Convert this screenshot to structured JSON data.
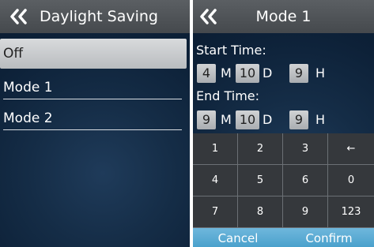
{
  "left_screen": {
    "title": "Daylight Saving",
    "back_icon": "double-chevron-left-icon",
    "menu": [
      {
        "label": "Off",
        "selected": true
      },
      {
        "label": "Mode 1",
        "selected": false
      },
      {
        "label": "Mode 2",
        "selected": false
      }
    ]
  },
  "right_screen": {
    "title": "Mode 1",
    "back_icon": "double-chevron-left-icon",
    "start_time": {
      "label": "Start Time:",
      "month_value": "4",
      "month_unit": "M",
      "day_value": "10",
      "day_unit": "D",
      "hour_value": "9",
      "hour_unit": "H"
    },
    "end_time": {
      "label": "End Time:",
      "month_value": "9",
      "month_unit": "M",
      "day_value": "10",
      "day_unit": "D",
      "hour_value": "9",
      "hour_unit": "H"
    },
    "keypad": {
      "rows": [
        [
          "1",
          "2",
          "3",
          "←"
        ],
        [
          "4",
          "5",
          "6",
          "0"
        ],
        [
          "7",
          "8",
          "9",
          "123"
        ]
      ]
    },
    "actions": {
      "cancel": "Cancel",
      "confirm": "Confirm",
      "color": "#5aaad3"
    }
  }
}
